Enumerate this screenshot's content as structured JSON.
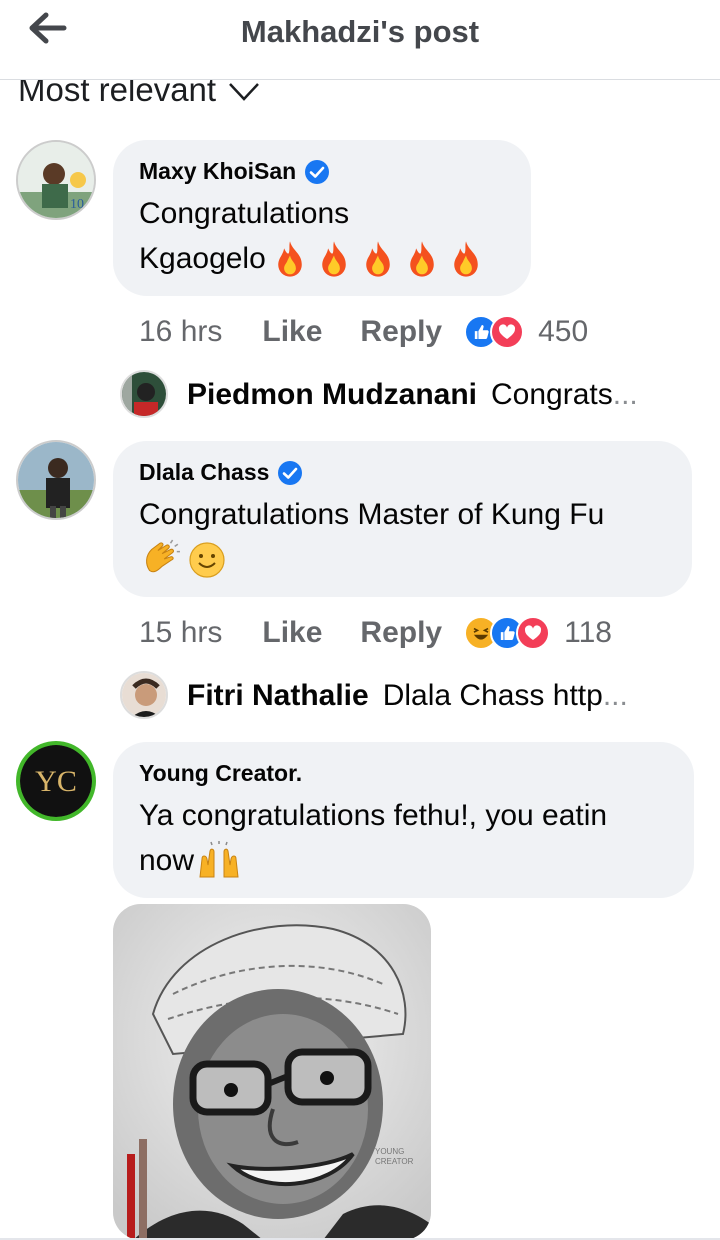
{
  "header": {
    "title": "Makhadzi's post",
    "back_icon": "arrow-left-icon"
  },
  "sort": {
    "label": "Most relevant",
    "icon": "chevron-down-icon"
  },
  "comments": [
    {
      "author": "Maxy KhoiSan",
      "verified": true,
      "text_line1": "Congratulations",
      "text_line2": "Kgaogelo",
      "emojis": "fire x5",
      "time": "16 hrs",
      "like_label": "Like",
      "reply_label": "Reply",
      "reaction_icons": [
        "like",
        "love"
      ],
      "reaction_count": "450",
      "reply": {
        "name": "Piedmon Mudzanani",
        "preview": "Congrats",
        "ellipsis": "..."
      }
    },
    {
      "author": "Dlala Chass",
      "verified": true,
      "text_line1": "Congratulations Master of Kung Fu",
      "emojis": "clapping-hands, smiling-face",
      "time": "15 hrs",
      "like_label": "Like",
      "reply_label": "Reply",
      "reaction_icons": [
        "haha",
        "like",
        "love"
      ],
      "reaction_count": "118",
      "reply": {
        "name": "Fitri Nathalie",
        "preview": "Dlala Chass http",
        "ellipsis": "..."
      }
    },
    {
      "author": "Young Creator.",
      "verified": false,
      "text_line1": "Ya congratulations fethu!, you eatin",
      "text_line2": "now",
      "emojis": "raising-hands",
      "has_image": true
    }
  ],
  "colors": {
    "verified_blue": "#1877f2",
    "bubble": "#f0f2f5",
    "meta_gray": "#65676b",
    "avatar_ring_green": "#42b72a"
  }
}
